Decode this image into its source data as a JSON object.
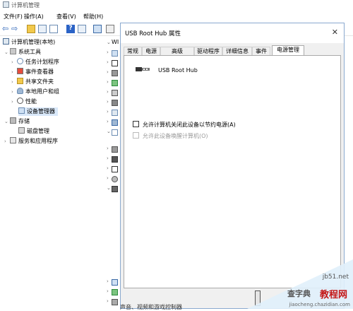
{
  "app": {
    "title": "计算机管理"
  },
  "menu": {
    "file": "文件(F)",
    "action": "操作(A)",
    "view": "查看(V)",
    "help": "帮助(H)"
  },
  "tree": {
    "root": "计算机管理(本地)",
    "system_tools": "系统工具",
    "task_scheduler": "任务计划程序",
    "event_viewer": "事件查看器",
    "shared_folders": "共享文件夹",
    "local_users": "本地用户和组",
    "performance": "性能",
    "device_manager": "设备管理器",
    "storage": "存储",
    "disk_management": "磁盘管理",
    "services_apps": "服务和应用程序"
  },
  "middle": {
    "top_label": "WI"
  },
  "dialog": {
    "title": "USB Root Hub 属性",
    "close": "✕",
    "tabs": [
      "常规",
      "电源",
      "高级",
      "驱动程序",
      "详细信息",
      "事件",
      "电源管理"
    ],
    "active_tab": "电源管理",
    "device_name": "USB Root Hub",
    "checkbox1_label": "允许计算机关闭此设备以节约电源(A)",
    "checkbox1_checked": false,
    "checkbox2_label": "允许此设备唤醒计算机(O)",
    "checkbox2_checked": false,
    "checkbox2_enabled": false
  },
  "watermark": {
    "line1": "查字典",
    "line2": "教程网",
    "line3": "jiaocheng.chazidian.com",
    "site": "jb51.net"
  },
  "bottom": {
    "text": "声音、视频和游戏控制器"
  },
  "colors": {
    "selection": "#d9e8f9",
    "dialog_border": "#8aa9cf",
    "watermark_red": "#c41717"
  }
}
